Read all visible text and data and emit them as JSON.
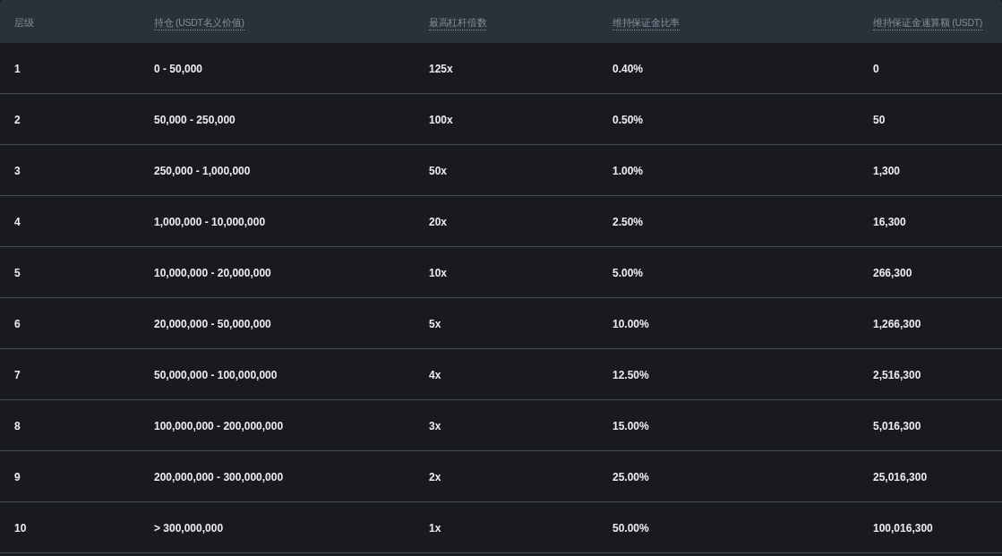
{
  "table": {
    "columns": [
      {
        "label": "层级",
        "dotted": false
      },
      {
        "label": "持仓 (USDT名义价值)",
        "dotted": true
      },
      {
        "label": "最高杠杆倍数",
        "dotted": true
      },
      {
        "label": "维持保证金比率",
        "dotted": true
      },
      {
        "label": "维持保证金速算额 (USDT)",
        "dotted": true
      }
    ],
    "rows": [
      [
        "1",
        "0 - 50,000",
        "125x",
        "0.40%",
        "0"
      ],
      [
        "2",
        "50,000 - 250,000",
        "100x",
        "0.50%",
        "50"
      ],
      [
        "3",
        "250,000 - 1,000,000",
        "50x",
        "1.00%",
        "1,300"
      ],
      [
        "4",
        "1,000,000 - 10,000,000",
        "20x",
        "2.50%",
        "16,300"
      ],
      [
        "5",
        "10,000,000 - 20,000,000",
        "10x",
        "5.00%",
        "266,300"
      ],
      [
        "6",
        "20,000,000 - 50,000,000",
        "5x",
        "10.00%",
        "1,266,300"
      ],
      [
        "7",
        "50,000,000 - 100,000,000",
        "4x",
        "12.50%",
        "2,516,300"
      ],
      [
        "8",
        "100,000,000 - 200,000,000",
        "3x",
        "15.00%",
        "5,016,300"
      ],
      [
        "9",
        "200,000,000 - 300,000,000",
        "2x",
        "25.00%",
        "25,016,300"
      ],
      [
        "10",
        "> 300,000,000",
        "1x",
        "50.00%",
        "100,016,300"
      ]
    ]
  }
}
